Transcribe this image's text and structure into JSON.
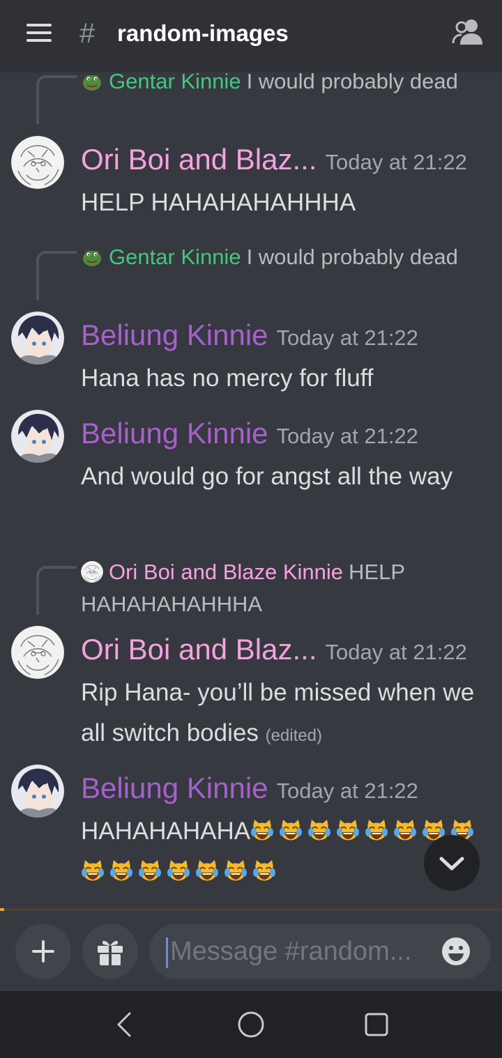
{
  "header": {
    "hash": "#",
    "channel": "random-images"
  },
  "messages": [
    {
      "reply": {
        "author": "Gentar Kinnie",
        "text": "I would probably dead"
      },
      "author": "Ori Boi and Blaz...",
      "timestamp": "Today at 21:22",
      "text": "HELP HAHAHAHAHHHA"
    },
    {
      "reply": {
        "author": "Gentar Kinnie",
        "text": "I would probably dead"
      },
      "author": "Beliung Kinnie",
      "timestamp": "Today at 21:22",
      "text": "Hana has no mercy for fluff"
    },
    {
      "author": "Beliung Kinnie",
      "timestamp": "Today at 21:22",
      "text": "And would go for angst all the way"
    },
    {
      "reply": {
        "author": "Ori Boi and Blaze Kinnie",
        "text": "HELP HAHAHAHAHHHA"
      },
      "author": "Ori Boi and Blaz...",
      "timestamp": "Today at 21:22",
      "text": "Rip Hana- you’ll be missed when we all switch bodies",
      "edited": "(edited)"
    },
    {
      "author": "Beliung Kinnie",
      "timestamp": "Today at 21:22",
      "text": "HAHAHAHAHA",
      "emoji_name": "joy-cat-emoji",
      "emoji_count": 15
    }
  ],
  "composer": {
    "placeholder": "Message #random..."
  },
  "colors": {
    "background": "#36393f",
    "header": "#2f3136",
    "ori_name": "#f7a1e0",
    "beliung_name": "#a85fcf",
    "gentar_name": "#43c77f",
    "accent_line": "#f0a332"
  },
  "icons": [
    "hamburger-icon",
    "members-icon",
    "plus-icon",
    "gift-icon",
    "emoji-icon",
    "chevron-down-icon",
    "nav-back-icon",
    "nav-home-icon",
    "nav-recents-icon"
  ]
}
